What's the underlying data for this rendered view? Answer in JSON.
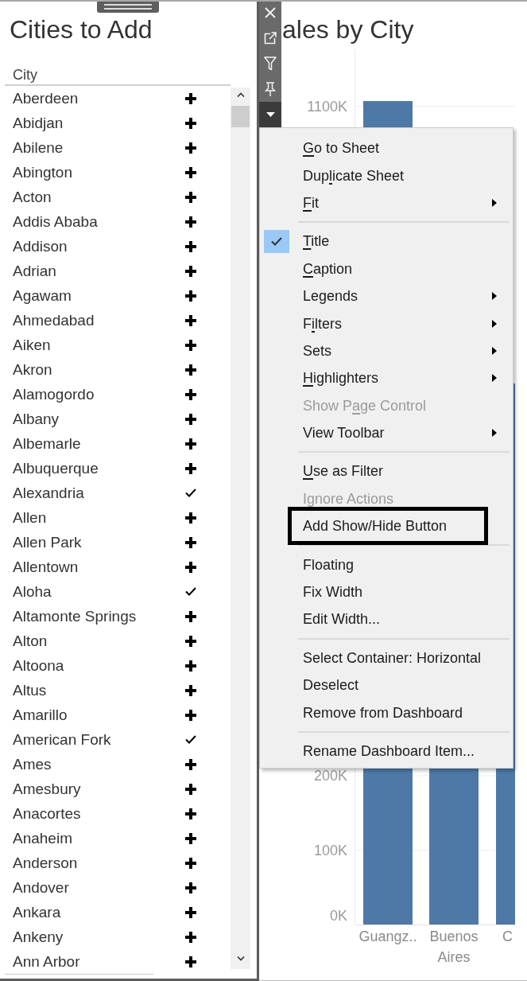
{
  "left_panel": {
    "title": "Cities to Add",
    "column_header": "City",
    "rows": [
      {
        "city": "Aberdeen",
        "added": false
      },
      {
        "city": "Abidjan",
        "added": false
      },
      {
        "city": "Abilene",
        "added": false
      },
      {
        "city": "Abington",
        "added": false
      },
      {
        "city": "Acton",
        "added": false
      },
      {
        "city": "Addis Ababa",
        "added": false
      },
      {
        "city": "Addison",
        "added": false
      },
      {
        "city": "Adrian",
        "added": false
      },
      {
        "city": "Agawam",
        "added": false
      },
      {
        "city": "Ahmedabad",
        "added": false
      },
      {
        "city": "Aiken",
        "added": false
      },
      {
        "city": "Akron",
        "added": false
      },
      {
        "city": "Alamogordo",
        "added": false
      },
      {
        "city": "Albany",
        "added": false
      },
      {
        "city": "Albemarle",
        "added": false
      },
      {
        "city": "Albuquerque",
        "added": false
      },
      {
        "city": "Alexandria",
        "added": true
      },
      {
        "city": "Allen",
        "added": false
      },
      {
        "city": "Allen Park",
        "added": false
      },
      {
        "city": "Allentown",
        "added": false
      },
      {
        "city": "Aloha",
        "added": true
      },
      {
        "city": "Altamonte Springs",
        "added": false
      },
      {
        "city": "Alton",
        "added": false
      },
      {
        "city": "Altoona",
        "added": false
      },
      {
        "city": "Altus",
        "added": false
      },
      {
        "city": "Amarillo",
        "added": false
      },
      {
        "city": "American Fork",
        "added": true
      },
      {
        "city": "Ames",
        "added": false
      },
      {
        "city": "Amesbury",
        "added": false
      },
      {
        "city": "Anacortes",
        "added": false
      },
      {
        "city": "Anaheim",
        "added": false
      },
      {
        "city": "Anderson",
        "added": false
      },
      {
        "city": "Andover",
        "added": false
      },
      {
        "city": "Ankara",
        "added": false
      },
      {
        "city": "Ankeny",
        "added": false
      },
      {
        "city": "Ann Arbor",
        "added": false
      }
    ]
  },
  "toolbar": [
    {
      "kind": "close",
      "active": false
    },
    {
      "kind": "popout",
      "active": false
    },
    {
      "kind": "filter",
      "active": false
    },
    {
      "kind": "pin",
      "active": false
    },
    {
      "kind": "menu",
      "active": true
    }
  ],
  "sheet": {
    "title": "ales by City",
    "chart": {
      "y_tick_labels": [
        "1100K",
        "200K",
        "100K",
        "0K"
      ],
      "category_labels": [
        "Guangz..",
        "Buenos Aires",
        "C"
      ]
    }
  },
  "context_menu": {
    "items": [
      {
        "kind": "item",
        "label": [
          {
            "text": "G",
            "underline": true
          },
          {
            "text": "o to Sheet",
            "underline": false
          }
        ],
        "checked": false,
        "disabled": false,
        "submenu": false,
        "outlined": false
      },
      {
        "kind": "item",
        "label": [
          {
            "text": "Dup",
            "underline": false
          },
          {
            "text": "l",
            "underline": true
          },
          {
            "text": "icate Sheet",
            "underline": false
          }
        ],
        "checked": false,
        "disabled": false,
        "submenu": false,
        "outlined": false
      },
      {
        "kind": "item",
        "label": [
          {
            "text": "F",
            "underline": true
          },
          {
            "text": "it",
            "underline": false
          }
        ],
        "checked": false,
        "disabled": false,
        "submenu": true,
        "outlined": false
      },
      {
        "kind": "separator"
      },
      {
        "kind": "item",
        "label": [
          {
            "text": "T",
            "underline": true
          },
          {
            "text": "itle",
            "underline": false
          }
        ],
        "checked": true,
        "disabled": false,
        "submenu": false,
        "outlined": false
      },
      {
        "kind": "item",
        "label": [
          {
            "text": "C",
            "underline": true
          },
          {
            "text": "aption",
            "underline": false
          }
        ],
        "checked": false,
        "disabled": false,
        "submenu": false,
        "outlined": false
      },
      {
        "kind": "item",
        "label": [
          {
            "text": "Legends",
            "underline": false
          }
        ],
        "checked": false,
        "disabled": false,
        "submenu": true,
        "outlined": false
      },
      {
        "kind": "item",
        "label": [
          {
            "text": "F",
            "underline": false
          },
          {
            "text": "i",
            "underline": true
          },
          {
            "text": "lters",
            "underline": false
          }
        ],
        "checked": false,
        "disabled": false,
        "submenu": true,
        "outlined": false
      },
      {
        "kind": "item",
        "label": [
          {
            "text": "Sets",
            "underline": false
          }
        ],
        "checked": false,
        "disabled": false,
        "submenu": true,
        "outlined": false
      },
      {
        "kind": "item",
        "label": [
          {
            "text": "H",
            "underline": true
          },
          {
            "text": "ighlighters",
            "underline": false
          }
        ],
        "checked": false,
        "disabled": false,
        "submenu": true,
        "outlined": false
      },
      {
        "kind": "item",
        "label": [
          {
            "text": "Show P",
            "underline": false
          },
          {
            "text": "a",
            "underline": true
          },
          {
            "text": "ge Control",
            "underline": false
          }
        ],
        "checked": false,
        "disabled": true,
        "submenu": false,
        "outlined": false
      },
      {
        "kind": "item",
        "label": [
          {
            "text": "View Toolbar",
            "underline": false
          }
        ],
        "checked": false,
        "disabled": false,
        "submenu": true,
        "outlined": false
      },
      {
        "kind": "separator"
      },
      {
        "kind": "item",
        "label": [
          {
            "text": "U",
            "underline": true
          },
          {
            "text": "se as Filter",
            "underline": false
          }
        ],
        "checked": false,
        "disabled": false,
        "submenu": false,
        "outlined": false
      },
      {
        "kind": "item",
        "label": [
          {
            "text": "Ignore Actions",
            "underline": false
          }
        ],
        "checked": false,
        "disabled": true,
        "submenu": false,
        "outlined": false
      },
      {
        "kind": "item",
        "label": [
          {
            "text": "Add Show/Hide Button",
            "underline": false
          }
        ],
        "checked": false,
        "disabled": false,
        "submenu": false,
        "outlined": true
      },
      {
        "kind": "separator"
      },
      {
        "kind": "item",
        "label": [
          {
            "text": "Floating",
            "underline": false
          }
        ],
        "checked": false,
        "disabled": false,
        "submenu": false,
        "outlined": false
      },
      {
        "kind": "item",
        "label": [
          {
            "text": "Fix Width",
            "underline": false
          }
        ],
        "checked": false,
        "disabled": false,
        "submenu": false,
        "outlined": false
      },
      {
        "kind": "item",
        "label": [
          {
            "text": "Edit Width...",
            "underline": false
          }
        ],
        "checked": false,
        "disabled": false,
        "submenu": false,
        "outlined": false
      },
      {
        "kind": "separator"
      },
      {
        "kind": "item",
        "label": [
          {
            "text": "Select Container: Horizontal",
            "underline": false
          }
        ],
        "checked": false,
        "disabled": false,
        "submenu": false,
        "outlined": false
      },
      {
        "kind": "item",
        "label": [
          {
            "text": "Deselect",
            "underline": false
          }
        ],
        "checked": false,
        "disabled": false,
        "submenu": false,
        "outlined": false
      },
      {
        "kind": "item",
        "label": [
          {
            "text": "Remove from Dashboard",
            "underline": false
          }
        ],
        "checked": false,
        "disabled": false,
        "submenu": false,
        "outlined": false
      },
      {
        "kind": "separator"
      },
      {
        "kind": "item",
        "label": [
          {
            "text": "Rename Dashboard Item...",
            "underline": false
          }
        ],
        "checked": false,
        "disabled": false,
        "submenu": false,
        "outlined": false
      }
    ]
  }
}
